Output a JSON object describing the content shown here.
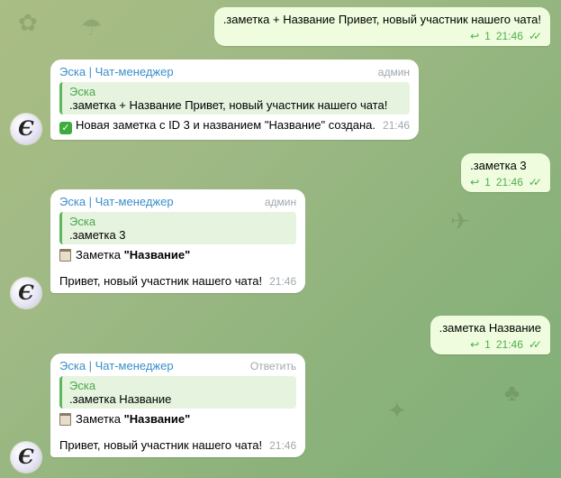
{
  "messages": {
    "out1": {
      "text": ".заметка + Название Привет, новый участник нашего чата!",
      "reply_count": "1",
      "time": "21:46"
    },
    "in1": {
      "sender": "Эска | Чат-менеджер",
      "role": "админ",
      "quote_name": "Эска",
      "quote_text": ".заметка + Название Привет, новый участник нашего чата!",
      "body": "Новая заметка с ID 3 и названием \"Название\" создана.",
      "time": "21:46"
    },
    "out2": {
      "text": ".заметка 3",
      "reply_count": "1",
      "time": "21:46"
    },
    "in2": {
      "sender": "Эска | Чат-менеджер",
      "role": "админ",
      "quote_name": "Эска",
      "quote_text": ".заметка 3",
      "note_prefix": "Заметка ",
      "note_title": "\"Название\"",
      "body": "Привет, новый участник нашего чата!",
      "time": "21:46"
    },
    "out3": {
      "text": ".заметка Название",
      "reply_count": "1",
      "time": "21:46"
    },
    "in3": {
      "sender": "Эска | Чат-менеджер",
      "role": "Ответить",
      "quote_name": "Эска",
      "quote_text": ".заметка Название",
      "note_prefix": "Заметка ",
      "note_title": "\"Название\"",
      "body": "Привет, новый участник нашего чата!",
      "time": "21:46"
    }
  },
  "avatar": {
    "glyph": "Є"
  },
  "colors": {
    "outgoing_bubble": "#effdde",
    "incoming_bubble": "#ffffff",
    "accent_green": "#4fae4e",
    "sender_blue": "#3a8fc9"
  }
}
